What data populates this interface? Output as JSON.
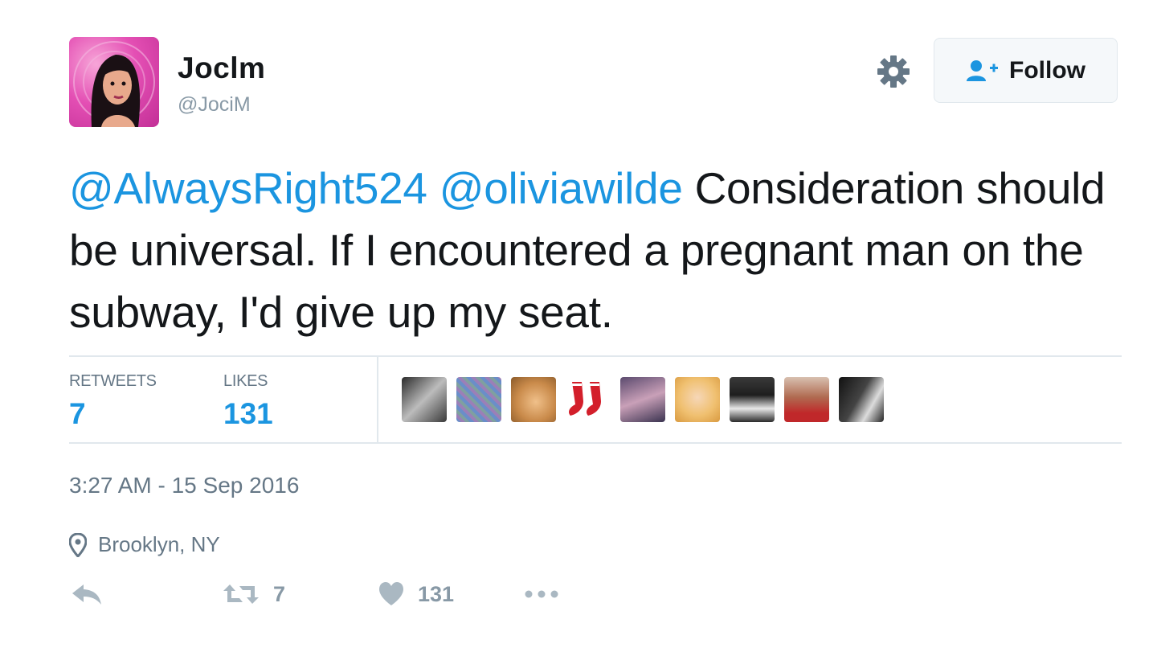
{
  "user": {
    "display_name": "Joclm",
    "screen_name": "@JociM"
  },
  "header": {
    "follow_label": "Follow"
  },
  "tweet": {
    "mention_1": "@AlwaysRight524",
    "mention_2": "@oliviawilde",
    "body": " Consideration should be universal. If I encountered a pregnant man on the subway, I'd give up my seat."
  },
  "stats": {
    "retweets_label": "RETWEETS",
    "retweets_count": "7",
    "likes_label": "LIKES",
    "likes_count": "131"
  },
  "meta": {
    "timestamp": "3:27 AM - 15 Sep 2016",
    "location": "Brooklyn, NY"
  },
  "actions": {
    "retweet_count": "7",
    "like_count": "131"
  },
  "colors": {
    "link": "#1b95e0",
    "muted": "#657786",
    "text": "#14171a"
  },
  "icons": [
    "gear-icon",
    "add-user-icon",
    "map-pin-icon",
    "reply-icon",
    "retweet-icon",
    "heart-icon",
    "more-icon"
  ]
}
